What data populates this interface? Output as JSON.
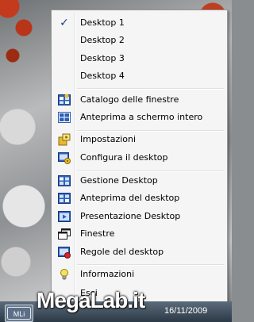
{
  "menu": {
    "desktops": [
      {
        "label": "Desktop 1",
        "checked": true
      },
      {
        "label": "Desktop 2",
        "checked": false
      },
      {
        "label": "Desktop 3",
        "checked": false
      },
      {
        "label": "Desktop 4",
        "checked": false
      }
    ],
    "group2": [
      {
        "label": "Catalogo delle finestre",
        "icon": "window-catalog-icon"
      },
      {
        "label": "Anteprima a schermo intero",
        "icon": "fullscreen-preview-icon"
      }
    ],
    "group3": [
      {
        "label": "Impostazioni",
        "icon": "settings-icon"
      },
      {
        "label": "Configura il desktop",
        "icon": "configure-desktop-icon"
      }
    ],
    "group4": [
      {
        "label": "Gestione Desktop",
        "icon": "desktop-manager-icon"
      },
      {
        "label": "Anteprima del desktop",
        "icon": "desktop-preview-icon"
      },
      {
        "label": "Presentazione Desktop",
        "icon": "desktop-presentation-icon"
      },
      {
        "label": "Finestre",
        "icon": "windows-icon"
      },
      {
        "label": "Regole del desktop",
        "icon": "desktop-rules-icon"
      }
    ],
    "group5": [
      {
        "label": "Informazioni",
        "icon": "lightbulb-icon"
      },
      {
        "label": "Esci",
        "icon": "exit-icon"
      }
    ]
  },
  "taskbar": {
    "clock": "16/11/2009",
    "tray_app": "MLi"
  },
  "watermark": "MegaLab.it",
  "colors": {
    "menu_bg": "#f5f5f5",
    "icon_blue": "#1f4fa8",
    "check": "#1a3f8a",
    "taskbar": "#2c3a47"
  }
}
